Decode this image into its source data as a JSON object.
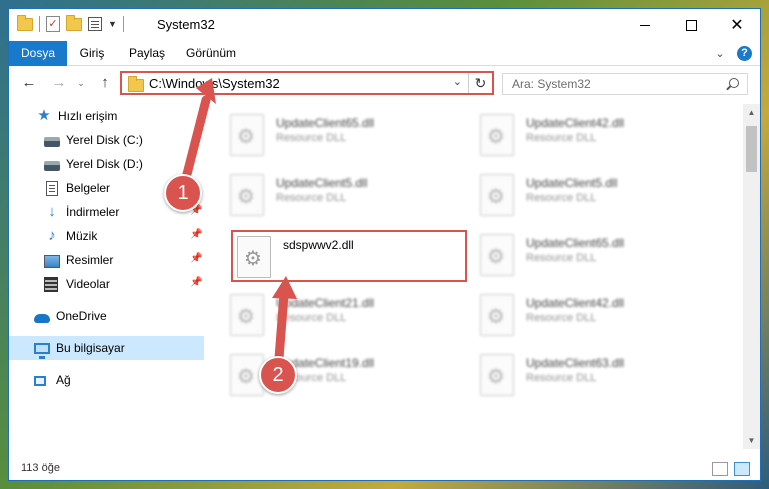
{
  "window": {
    "title": "System32"
  },
  "ribbon": {
    "tabs": [
      "Dosya",
      "Giriş",
      "Paylaş",
      "Görünüm"
    ],
    "help_glyph": "?"
  },
  "navigation": {
    "address": "C:\\Windows\\System32",
    "search_placeholder": "Ara: System32"
  },
  "sidebar": {
    "items": [
      {
        "label": "Hızlı erişim",
        "icon": "quick-access-icon",
        "pinned": false
      },
      {
        "label": "Yerel Disk (C:)",
        "icon": "drive-icon",
        "pinned": false
      },
      {
        "label": "Yerel Disk (D:)",
        "icon": "drive-icon",
        "pinned": true
      },
      {
        "label": "Belgeler",
        "icon": "documents-icon",
        "pinned": true
      },
      {
        "label": "İndirmeler",
        "icon": "downloads-icon",
        "pinned": true
      },
      {
        "label": "Müzik",
        "icon": "music-icon",
        "pinned": true
      },
      {
        "label": "Resimler",
        "icon": "pictures-icon",
        "pinned": true
      },
      {
        "label": "Videolar",
        "icon": "videos-icon",
        "pinned": true
      },
      {
        "label": "OneDrive",
        "icon": "onedrive-icon",
        "pinned": false
      },
      {
        "label": "Bu bilgisayar",
        "icon": "this-pc-icon",
        "pinned": false,
        "selected": true
      },
      {
        "label": "Ağ",
        "icon": "network-icon",
        "pinned": false
      }
    ]
  },
  "files": [
    {
      "name": "UpdateClient65.dll",
      "type": "Resource DLL",
      "blurred": true
    },
    {
      "name": "UpdateClient42.dll",
      "type": "Resource DLL",
      "blurred": true
    },
    {
      "name": "UpdateClient5.dll",
      "type": "Resource DLL",
      "blurred": true
    },
    {
      "name": "UpdateClient5.dll",
      "type": "Resource DLL",
      "blurred": true
    },
    {
      "name": "sdspwwv2.dll",
      "type": "",
      "blurred": false,
      "highlighted": true
    },
    {
      "name": "UpdateClient65.dll",
      "type": "Resource DLL",
      "blurred": true
    },
    {
      "name": "UpdateClient21.dll",
      "type": "Resource DLL",
      "blurred": true
    },
    {
      "name": "UpdateClient42.dll",
      "type": "Resource DLL",
      "blurred": true
    },
    {
      "name": "UpdateClient19.dll",
      "type": "Resource DLL",
      "blurred": true
    },
    {
      "name": "UpdateClient63.dll",
      "type": "Resource DLL",
      "blurred": true
    }
  ],
  "status": {
    "item_count": "113 öğe"
  },
  "annotations": {
    "step1": "1",
    "step2": "2",
    "color": "#d9534f"
  }
}
